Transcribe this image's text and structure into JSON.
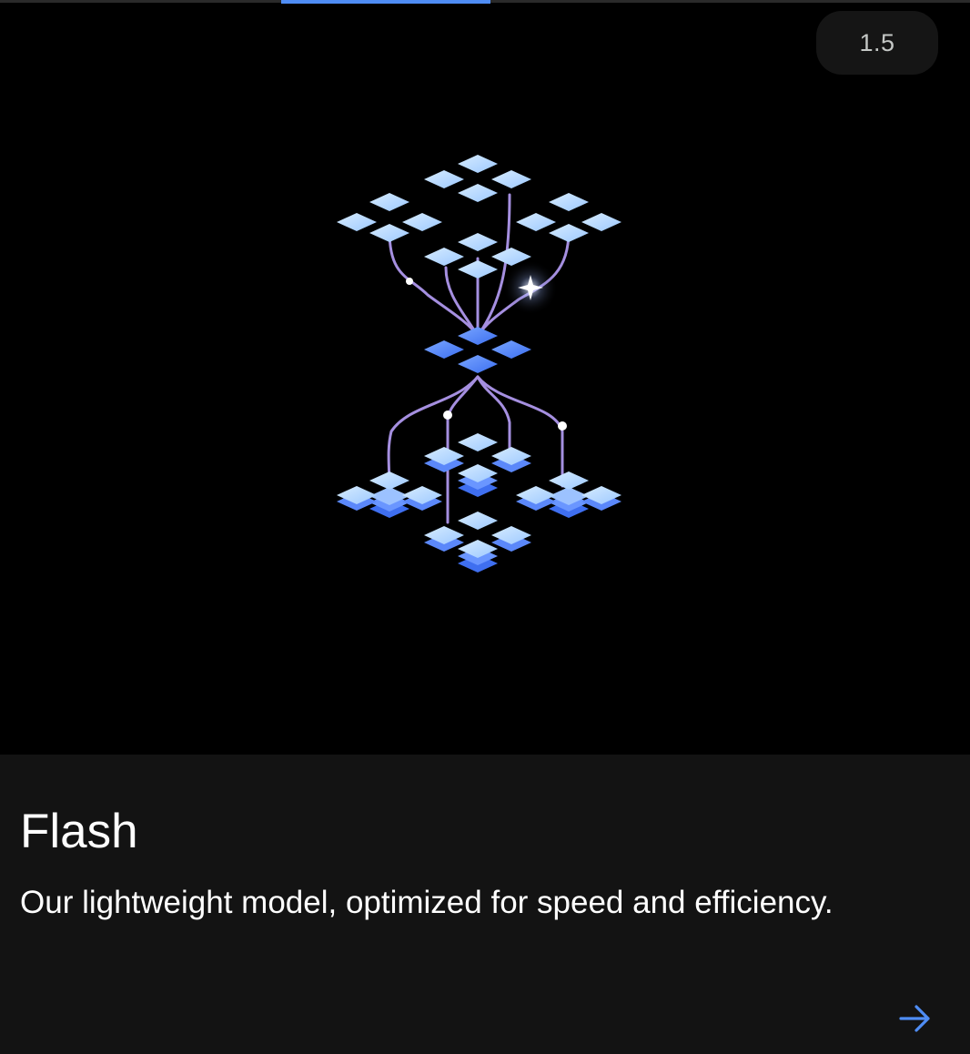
{
  "card": {
    "version": "1.5",
    "title": "Flash",
    "description": "Our lightweight model, optimized for speed and efficiency."
  },
  "colors": {
    "accent": "#4f8df5",
    "background": "#000000",
    "panel": "#131313",
    "pill": "#151515"
  },
  "icons": {
    "next": "arrow-right-icon",
    "illustration": "model-network-illustration"
  }
}
